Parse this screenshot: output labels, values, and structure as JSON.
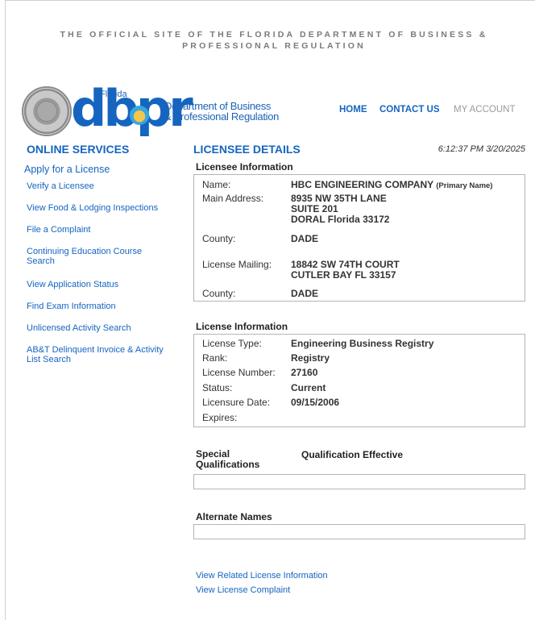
{
  "banner": "THE OFFICIAL SITE OF THE FLORIDA DEPARTMENT OF BUSINESS & PROFESSIONAL REGULATION",
  "logo": {
    "florida": "Florida",
    "dbpr": "dbpr",
    "dept_line1": "Department of Business",
    "dept_line2": "& Professional Regulation"
  },
  "topnav": {
    "home": "HOME",
    "contact": "CONTACT US",
    "account": "MY ACCOUNT"
  },
  "online_services": {
    "title": "ONLINE SERVICES",
    "apply": "Apply for a License",
    "items": [
      "Verify a Licensee",
      "View Food & Lodging Inspections",
      "File a Complaint",
      "Continuing Education Course Search",
      "View Application Status",
      "Find Exam Information",
      "Unlicensed Activity Search",
      "AB&T Delinquent Invoice & Activity List Search"
    ]
  },
  "licensee_details": {
    "title": "LICENSEE DETAILS",
    "timestamp": "6:12:37 PM 3/20/2025",
    "licensee_info": {
      "title": "Licensee Information",
      "name_label": "Name:",
      "name_value": "HBC ENGINEERING COMPANY",
      "name_suffix": "(Primary Name)",
      "address_label": "Main Address:",
      "address_line1": "8935 NW 35TH LANE",
      "address_line2": "SUITE 201",
      "address_line3": "DORAL  Florida  33172",
      "county_label": "County:",
      "county_value": "DADE",
      "mailing_label": "License Mailing:",
      "mailing_line1": "18842 SW 74TH COURT",
      "mailing_line2": "CUTLER BAY  FL  33157",
      "county2_label": "County:",
      "county2_value": "DADE"
    },
    "license_info": {
      "title": "License Information",
      "type_label": "License Type:",
      "type_value": "Engineering Business Registry",
      "rank_label": "Rank:",
      "rank_value": "Registry",
      "number_label": "License Number:",
      "number_value": "27160",
      "status_label": "Status:",
      "status_value": "Current",
      "date_label": "Licensure Date:",
      "date_value": "09/15/2006",
      "expires_label": "Expires:",
      "expires_value": ""
    },
    "special_qualifications": {
      "title": "Special Qualifications",
      "effective": "Qualification Effective"
    },
    "alternate_names": {
      "title": "Alternate Names"
    },
    "links": {
      "related": "View Related License Information",
      "complaint": "View License Complaint"
    }
  }
}
